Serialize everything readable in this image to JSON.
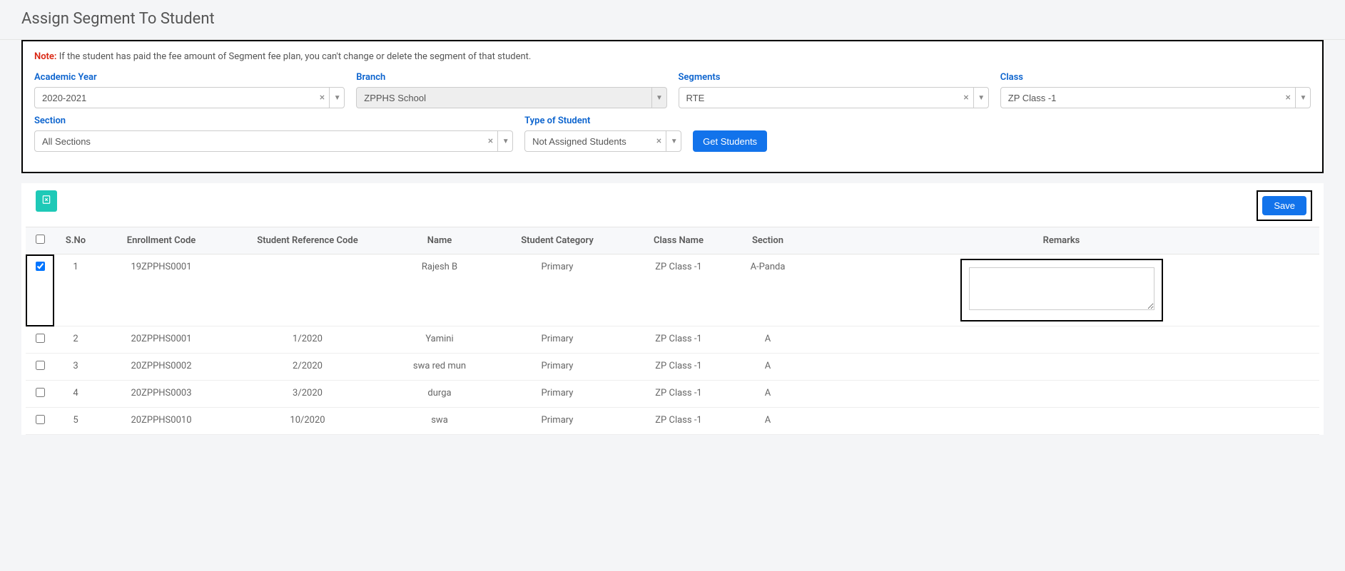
{
  "header": {
    "title": "Assign Segment To Student"
  },
  "note": {
    "label": "Note:",
    "text": "If the student has paid the fee amount of Segment fee plan, you can't change or delete the segment of that student."
  },
  "filters": {
    "academic_year": {
      "label": "Academic Year",
      "value": "2020-2021"
    },
    "branch": {
      "label": "Branch",
      "value": "ZPPHS School"
    },
    "segments": {
      "label": "Segments",
      "value": "RTE"
    },
    "class": {
      "label": "Class",
      "value": "ZP Class -1"
    },
    "section": {
      "label": "Section",
      "value": "All Sections"
    },
    "type": {
      "label": "Type of Student",
      "value": "Not Assigned Students"
    },
    "get_button": "Get Students"
  },
  "toolbar": {
    "save_label": "Save"
  },
  "table": {
    "headers": {
      "sno": "S.No",
      "enroll": "Enrollment Code",
      "ref": "Student Reference Code",
      "name": "Name",
      "category": "Student Category",
      "class": "Class Name",
      "section": "Section",
      "remarks": "Remarks"
    },
    "rows": [
      {
        "checked": true,
        "sno": "1",
        "enroll": "19ZPPHS0001",
        "ref": "",
        "name": "Rajesh B",
        "category": "Primary",
        "class": "ZP Class -1",
        "section": "A-Panda",
        "remarks_editable": true,
        "remarks": ""
      },
      {
        "checked": false,
        "sno": "2",
        "enroll": "20ZPPHS0001",
        "ref": "1/2020",
        "name": "Yamini",
        "category": "Primary",
        "class": "ZP Class -1",
        "section": "A",
        "remarks_editable": false,
        "remarks": ""
      },
      {
        "checked": false,
        "sno": "3",
        "enroll": "20ZPPHS0002",
        "ref": "2/2020",
        "name": "swa red mun",
        "category": "Primary",
        "class": "ZP Class -1",
        "section": "A",
        "remarks_editable": false,
        "remarks": ""
      },
      {
        "checked": false,
        "sno": "4",
        "enroll": "20ZPPHS0003",
        "ref": "3/2020",
        "name": "durga",
        "category": "Primary",
        "class": "ZP Class -1",
        "section": "A",
        "remarks_editable": false,
        "remarks": ""
      },
      {
        "checked": false,
        "sno": "5",
        "enroll": "20ZPPHS0010",
        "ref": "10/2020",
        "name": "swa",
        "category": "Primary",
        "class": "ZP Class -1",
        "section": "A",
        "remarks_editable": false,
        "remarks": ""
      }
    ]
  }
}
